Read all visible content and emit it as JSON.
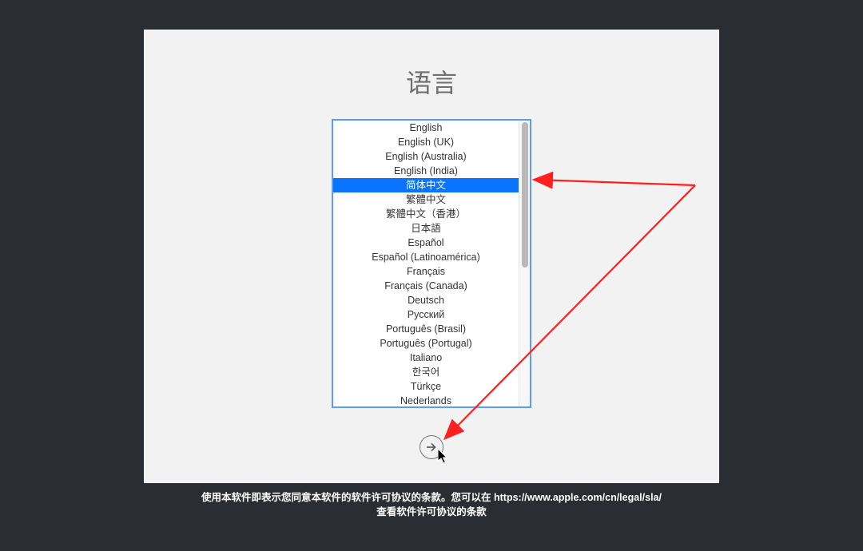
{
  "title": "语言",
  "selectedIndex": 4,
  "languages": [
    "English",
    "English (UK)",
    "English (Australia)",
    "English (India)",
    "简体中文",
    "繁體中文",
    "繁體中文（香港）",
    "日本語",
    "Español",
    "Español (Latinoamérica)",
    "Français",
    "Français (Canada)",
    "Deutsch",
    "Русский",
    "Português (Brasil)",
    "Português (Portugal)",
    "Italiano",
    "한국어",
    "Türkçe",
    "Nederlands"
  ],
  "legal": {
    "line1_prefix": "使用本软件即表示您同意本软件的软件许可协议的条款。您可以在 ",
    "line1_url": "https://www.apple.com/cn/legal/sla/",
    "line2": "查看软件许可协议的条款"
  }
}
